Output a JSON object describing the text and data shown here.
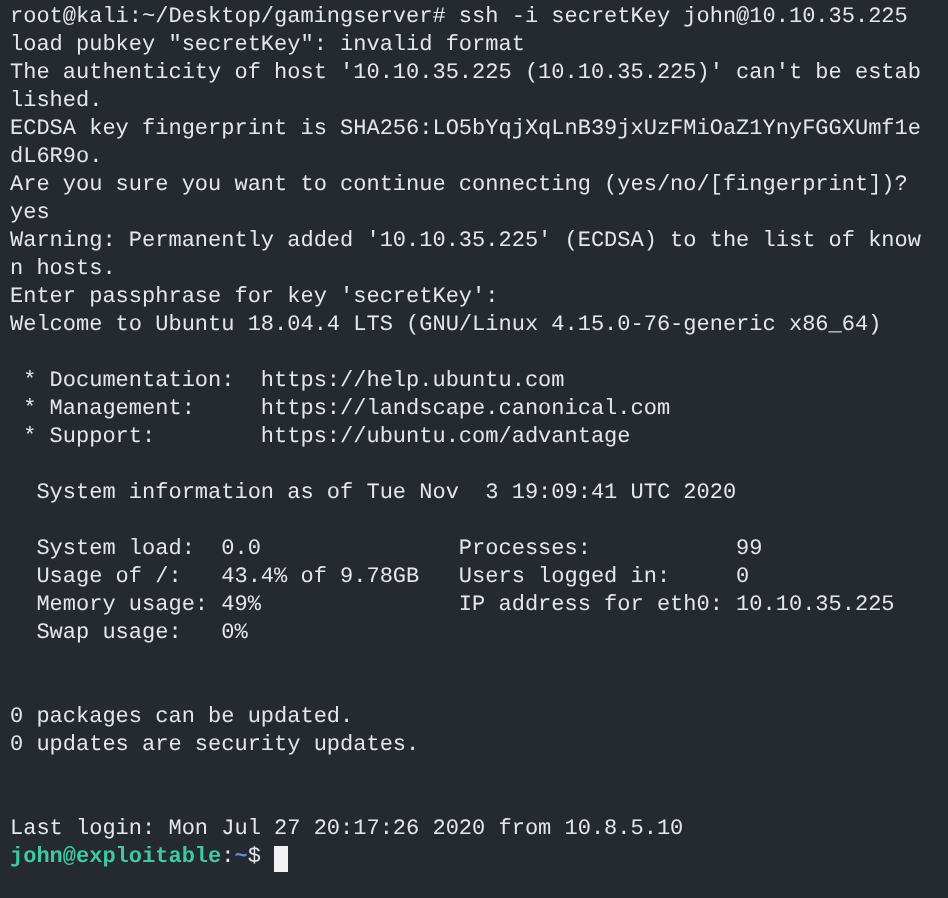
{
  "terminal": {
    "lines": [
      {
        "kind": "output",
        "text": "root@kali:~/Desktop/gamingserver# ssh -i secretKey john@10.10.35.225"
      },
      {
        "kind": "output",
        "text": "load pubkey \"secretKey\": invalid format"
      },
      {
        "kind": "output",
        "text": "The authenticity of host '10.10.35.225 (10.10.35.225)' can't be estab"
      },
      {
        "kind": "output",
        "text": "lished."
      },
      {
        "kind": "output",
        "text": "ECDSA key fingerprint is SHA256:LO5bYqjXqLnB39jxUzFMiOaZ1YnyFGGXUmf1e"
      },
      {
        "kind": "output",
        "text": "dL6R9o."
      },
      {
        "kind": "output",
        "text": "Are you sure you want to continue connecting (yes/no/[fingerprint])?"
      },
      {
        "kind": "output",
        "text": "yes"
      },
      {
        "kind": "output",
        "text": "Warning: Permanently added '10.10.35.225' (ECDSA) to the list of know"
      },
      {
        "kind": "output",
        "text": "n hosts."
      },
      {
        "kind": "output",
        "text": "Enter passphrase for key 'secretKey':"
      },
      {
        "kind": "output",
        "text": "Welcome to Ubuntu 18.04.4 LTS (GNU/Linux 4.15.0-76-generic x86_64)"
      },
      {
        "kind": "blank"
      },
      {
        "kind": "output",
        "text": " * Documentation:  https://help.ubuntu.com"
      },
      {
        "kind": "output",
        "text": " * Management:     https://landscape.canonical.com"
      },
      {
        "kind": "output",
        "text": " * Support:        https://ubuntu.com/advantage"
      },
      {
        "kind": "blank"
      },
      {
        "kind": "output",
        "text": "  System information as of Tue Nov  3 19:09:41 UTC 2020"
      },
      {
        "kind": "blank"
      },
      {
        "kind": "output",
        "text": "  System load:  0.0               Processes:           99"
      },
      {
        "kind": "output",
        "text": "  Usage of /:   43.4% of 9.78GB   Users logged in:     0"
      },
      {
        "kind": "output",
        "text": "  Memory usage: 49%               IP address for eth0: 10.10.35.225"
      },
      {
        "kind": "output",
        "text": "  Swap usage:   0%"
      },
      {
        "kind": "blank"
      },
      {
        "kind": "blank"
      },
      {
        "kind": "output",
        "text": "0 packages can be updated."
      },
      {
        "kind": "output",
        "text": "0 updates are security updates."
      },
      {
        "kind": "blank"
      },
      {
        "kind": "blank"
      },
      {
        "kind": "output",
        "text": "Last login: Mon Jul 27 20:17:26 2020 from 10.8.5.10"
      },
      {
        "kind": "prompt",
        "user_host": "john@exploitable",
        "separator": ":",
        "path": "~",
        "symbol": "$"
      }
    ]
  }
}
